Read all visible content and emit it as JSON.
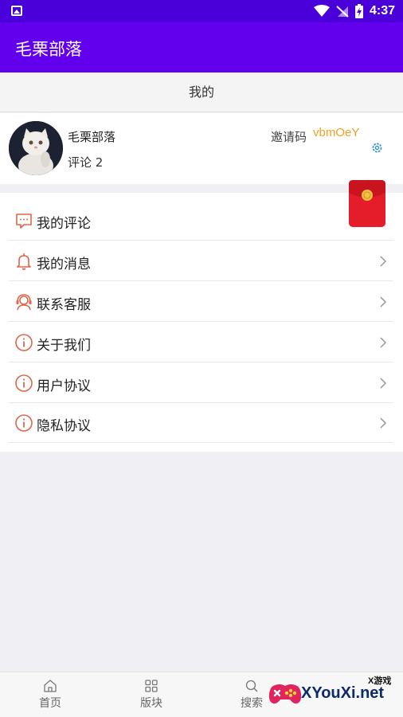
{
  "status_bar": {
    "time": "4:37"
  },
  "app_bar": {
    "title": "毛栗部落"
  },
  "page_header": {
    "title": "我的"
  },
  "profile": {
    "username": "毛栗部落",
    "comments": "评论 2",
    "invite_label": "邀请码",
    "invite_code": "vbmOeY"
  },
  "menu": {
    "items": [
      {
        "label": "我的评论",
        "icon": "comment-icon"
      },
      {
        "label": "我的消息",
        "icon": "bell-icon"
      },
      {
        "label": "联系客服",
        "icon": "headset-icon"
      },
      {
        "label": "关于我们",
        "icon": "info-icon"
      },
      {
        "label": "用户协议",
        "icon": "info-icon"
      },
      {
        "label": "隐私协议",
        "icon": "info-icon"
      }
    ]
  },
  "bottom_nav": {
    "items": [
      {
        "label": "首页",
        "icon": "home-icon"
      },
      {
        "label": "版块",
        "icon": "grid-icon"
      },
      {
        "label": "搜索",
        "icon": "search-icon"
      }
    ]
  },
  "watermark": {
    "text": "XYouXi.net",
    "small": "X游戏"
  },
  "colors": {
    "status_bar": "#4a00d8",
    "app_bar": "#6200ee",
    "icon_accent": "#e0664a",
    "invite_code": "#f0a020",
    "settings": "#2a8fd8"
  }
}
